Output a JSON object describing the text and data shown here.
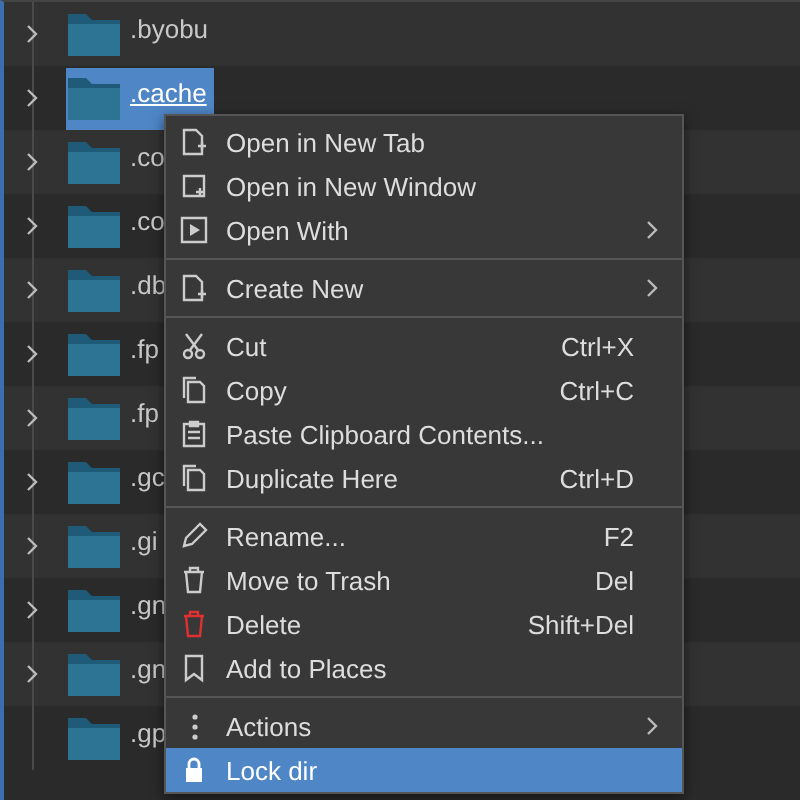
{
  "files": [
    {
      "name": ".byobu",
      "expandable": true,
      "selected": false
    },
    {
      "name": ".cache",
      "expandable": true,
      "selected": true
    },
    {
      "name": ".co",
      "expandable": true,
      "selected": false
    },
    {
      "name": ".co",
      "expandable": true,
      "selected": false
    },
    {
      "name": ".db",
      "expandable": true,
      "selected": false
    },
    {
      "name": ".fp",
      "expandable": true,
      "selected": false
    },
    {
      "name": ".fp",
      "expandable": true,
      "selected": false
    },
    {
      "name": ".gc",
      "expandable": true,
      "selected": false
    },
    {
      "name": ".gi",
      "expandable": true,
      "selected": false
    },
    {
      "name": ".gn",
      "expandable": true,
      "selected": false
    },
    {
      "name": ".gn",
      "expandable": true,
      "selected": false
    },
    {
      "name": ".gp",
      "expandable": false,
      "selected": false
    }
  ],
  "context_menu": {
    "items": [
      {
        "kind": "item",
        "label": "Open in New Tab",
        "submenu": false,
        "danger": false,
        "highlighted": false
      },
      {
        "kind": "item",
        "label": "Open in New Window",
        "submenu": false,
        "danger": false,
        "highlighted": false
      },
      {
        "kind": "item",
        "label": "Open With",
        "submenu": true,
        "danger": false,
        "highlighted": false
      },
      {
        "kind": "separator"
      },
      {
        "kind": "item",
        "label": "Create New",
        "submenu": true,
        "danger": false,
        "highlighted": false
      },
      {
        "kind": "separator"
      },
      {
        "kind": "item",
        "label": "Cut",
        "shortcut": "Ctrl+X",
        "submenu": false,
        "danger": false,
        "highlighted": false
      },
      {
        "kind": "item",
        "label": "Copy",
        "shortcut": "Ctrl+C",
        "submenu": false,
        "danger": false,
        "highlighted": false
      },
      {
        "kind": "item",
        "label": "Paste Clipboard Contents...",
        "submenu": false,
        "danger": false,
        "highlighted": false
      },
      {
        "kind": "item",
        "label": "Duplicate Here",
        "shortcut": "Ctrl+D",
        "submenu": false,
        "danger": false,
        "highlighted": false
      },
      {
        "kind": "separator"
      },
      {
        "kind": "item",
        "label": "Rename...",
        "shortcut": "F2",
        "submenu": false,
        "danger": false,
        "highlighted": false
      },
      {
        "kind": "item",
        "label": "Move to Trash",
        "shortcut": "Del",
        "submenu": false,
        "danger": false,
        "highlighted": false
      },
      {
        "kind": "item",
        "label": "Delete",
        "shortcut": "Shift+Del",
        "submenu": false,
        "danger": true,
        "highlighted": false
      },
      {
        "kind": "item",
        "label": "Add to Places",
        "submenu": false,
        "danger": false,
        "highlighted": false
      },
      {
        "kind": "separator"
      },
      {
        "kind": "item",
        "label": "Actions",
        "submenu": true,
        "danger": false,
        "highlighted": false
      },
      {
        "kind": "item",
        "label": "Lock dir",
        "submenu": false,
        "danger": false,
        "highlighted": true
      }
    ]
  }
}
